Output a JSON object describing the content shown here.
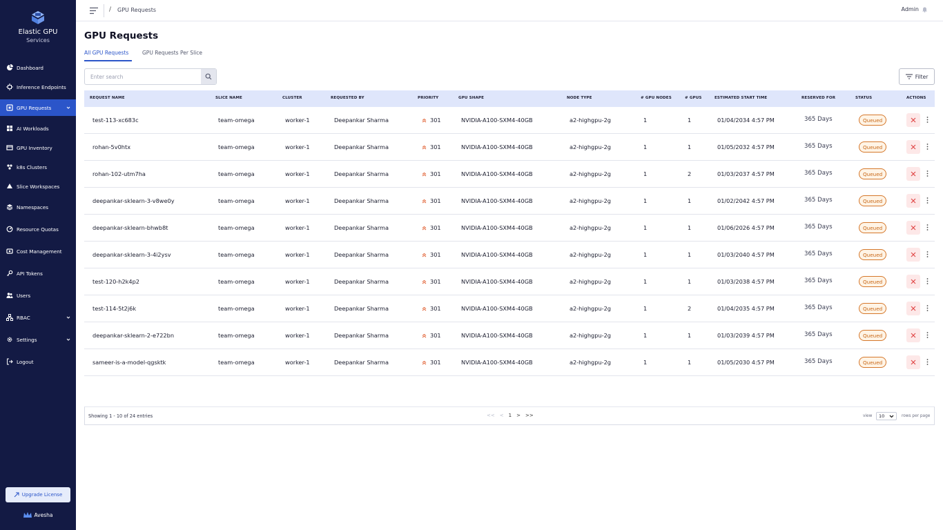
{
  "app": {
    "title": "Elastic GPU",
    "subtitle": "Services"
  },
  "sidebar": {
    "items": [
      {
        "label": "Dashboard",
        "icon": "dashboard-icon",
        "active": false,
        "expandable": false
      },
      {
        "label": "Inference Endpoints",
        "icon": "inference-icon",
        "active": false,
        "expandable": false
      },
      {
        "label": "GPU Requests",
        "icon": "gpu-requests-icon",
        "active": true,
        "expandable": true
      },
      {
        "label": "AI Workloads",
        "icon": "workloads-icon",
        "active": false,
        "expandable": false
      },
      {
        "label": "GPU Inventory",
        "icon": "inventory-icon",
        "active": false,
        "expandable": false
      },
      {
        "label": "k8s Clusters",
        "icon": "clusters-icon",
        "active": false,
        "expandable": false
      },
      {
        "label": "Slice Workspaces",
        "icon": "workspaces-icon",
        "active": false,
        "expandable": false
      },
      {
        "label": "Namespaces",
        "icon": "namespaces-icon",
        "active": false,
        "expandable": false
      },
      {
        "label": "Resource Quotas",
        "icon": "quotas-icon",
        "active": false,
        "expandable": false
      },
      {
        "label": "Cost Management",
        "icon": "cost-icon",
        "active": false,
        "expandable": false
      },
      {
        "label": "API Tokens",
        "icon": "key-icon",
        "active": false,
        "expandable": false
      },
      {
        "label": "Users",
        "icon": "users-icon",
        "active": false,
        "expandable": false
      },
      {
        "label": "RBAC",
        "icon": "rbac-icon",
        "active": false,
        "expandable": true
      },
      {
        "label": "Settings",
        "icon": "settings-icon",
        "active": false,
        "expandable": true
      },
      {
        "label": "Logout",
        "icon": "logout-icon",
        "active": false,
        "expandable": false
      }
    ],
    "upgrade_label": "Upgrade License",
    "vendor": "Avesha"
  },
  "topbar": {
    "separator": "/",
    "breadcrumb": "GPU Requests",
    "user": "Admin"
  },
  "page": {
    "title": "GPU Requests",
    "tabs": [
      {
        "label": "All GPU Requests",
        "active": true
      },
      {
        "label": "GPU Requests Per Slice",
        "active": false
      }
    ],
    "search_placeholder": "Enter search",
    "filter_label": "Filter"
  },
  "table": {
    "columns": [
      "REQUEST NAME",
      "SLICE NAME",
      "CLUSTER",
      "REQUESTED BY",
      "PRIORITY",
      "GPU SHAPE",
      "NODE TYPE",
      "# GPU NODES",
      "# GPUS",
      "ESTIMATED START TIME",
      "RESERVED FOR",
      "STATUS",
      "ACTIONS"
    ],
    "rows": [
      {
        "name": "test-113-xc683c",
        "slice": "team-omega",
        "cluster": "worker-1",
        "requested_by": "Deepankar Sharma",
        "priority": "301",
        "gpu_shape": "NVIDIA-A100-SXM4-40GB",
        "node_type": "a2-highgpu-2g",
        "gpu_nodes": "1",
        "gpus": "1",
        "start_time": "01/04/2034 4:57 PM",
        "reserved": "365 Days",
        "status": "Queued"
      },
      {
        "name": "rohan-5v0htx",
        "slice": "team-omega",
        "cluster": "worker-1",
        "requested_by": "Deepankar Sharma",
        "priority": "301",
        "gpu_shape": "NVIDIA-A100-SXM4-40GB",
        "node_type": "a2-highgpu-2g",
        "gpu_nodes": "1",
        "gpus": "1",
        "start_time": "01/05/2032 4:57 PM",
        "reserved": "365 Days",
        "status": "Queued"
      },
      {
        "name": "rohan-102-utm7ha",
        "slice": "team-omega",
        "cluster": "worker-1",
        "requested_by": "Deepankar Sharma",
        "priority": "301",
        "gpu_shape": "NVIDIA-A100-SXM4-40GB",
        "node_type": "a2-highgpu-2g",
        "gpu_nodes": "1",
        "gpus": "2",
        "start_time": "01/03/2037 4:57 PM",
        "reserved": "365 Days",
        "status": "Queued"
      },
      {
        "name": "deepankar-sklearn-3-v8we0y",
        "slice": "team-omega",
        "cluster": "worker-1",
        "requested_by": "Deepankar Sharma",
        "priority": "301",
        "gpu_shape": "NVIDIA-A100-SXM4-40GB",
        "node_type": "a2-highgpu-2g",
        "gpu_nodes": "1",
        "gpus": "1",
        "start_time": "01/02/2042 4:57 PM",
        "reserved": "365 Days",
        "status": "Queued"
      },
      {
        "name": "deepankar-sklearn-bhwb8t",
        "slice": "team-omega",
        "cluster": "worker-1",
        "requested_by": "Deepankar Sharma",
        "priority": "301",
        "gpu_shape": "NVIDIA-A100-SXM4-40GB",
        "node_type": "a2-highgpu-2g",
        "gpu_nodes": "1",
        "gpus": "1",
        "start_time": "01/06/2026 4:57 PM",
        "reserved": "365 Days",
        "status": "Queued"
      },
      {
        "name": "deepankar-sklearn-3-4i2ysv",
        "slice": "team-omega",
        "cluster": "worker-1",
        "requested_by": "Deepankar Sharma",
        "priority": "301",
        "gpu_shape": "NVIDIA-A100-SXM4-40GB",
        "node_type": "a2-highgpu-2g",
        "gpu_nodes": "1",
        "gpus": "1",
        "start_time": "01/03/2040 4:57 PM",
        "reserved": "365 Days",
        "status": "Queued"
      },
      {
        "name": "test-120-h2k4p2",
        "slice": "team-omega",
        "cluster": "worker-1",
        "requested_by": "Deepankar Sharma",
        "priority": "301",
        "gpu_shape": "NVIDIA-A100-SXM4-40GB",
        "node_type": "a2-highgpu-2g",
        "gpu_nodes": "1",
        "gpus": "1",
        "start_time": "01/03/2038 4:57 PM",
        "reserved": "365 Days",
        "status": "Queued"
      },
      {
        "name": "test-114-5t2j6k",
        "slice": "team-omega",
        "cluster": "worker-1",
        "requested_by": "Deepankar Sharma",
        "priority": "301",
        "gpu_shape": "NVIDIA-A100-SXM4-40GB",
        "node_type": "a2-highgpu-2g",
        "gpu_nodes": "1",
        "gpus": "2",
        "start_time": "01/04/2035 4:57 PM",
        "reserved": "365 Days",
        "status": "Queued"
      },
      {
        "name": "deepankar-sklearn-2-e722bn",
        "slice": "team-omega",
        "cluster": "worker-1",
        "requested_by": "Deepankar Sharma",
        "priority": "301",
        "gpu_shape": "NVIDIA-A100-SXM4-40GB",
        "node_type": "a2-highgpu-2g",
        "gpu_nodes": "1",
        "gpus": "1",
        "start_time": "01/03/2039 4:57 PM",
        "reserved": "365 Days",
        "status": "Queued"
      },
      {
        "name": "sameer-is-a-model-qgsktk",
        "slice": "team-omega",
        "cluster": "worker-1",
        "requested_by": "Deepankar Sharma",
        "priority": "301",
        "gpu_shape": "NVIDIA-A100-SXM4-40GB",
        "node_type": "a2-highgpu-2g",
        "gpu_nodes": "1",
        "gpus": "1",
        "start_time": "01/05/2030 4:57 PM",
        "reserved": "365 Days",
        "status": "Queued"
      }
    ]
  },
  "pagination": {
    "showing": "Showing 1 - 10 of 24 entries",
    "first": "<<",
    "prev": "<",
    "page": "1",
    "next": ">",
    "last": ">>",
    "view_label": "view",
    "rows_per_page": "10",
    "rows_label": "rows per page"
  },
  "colors": {
    "sidebar_bg": "#131a44",
    "accent": "#2b55c9",
    "header_bg": "#dfe6fb",
    "status_queued": "#d5772a",
    "priority": "#e05a2a",
    "cancel": "#e04646"
  }
}
